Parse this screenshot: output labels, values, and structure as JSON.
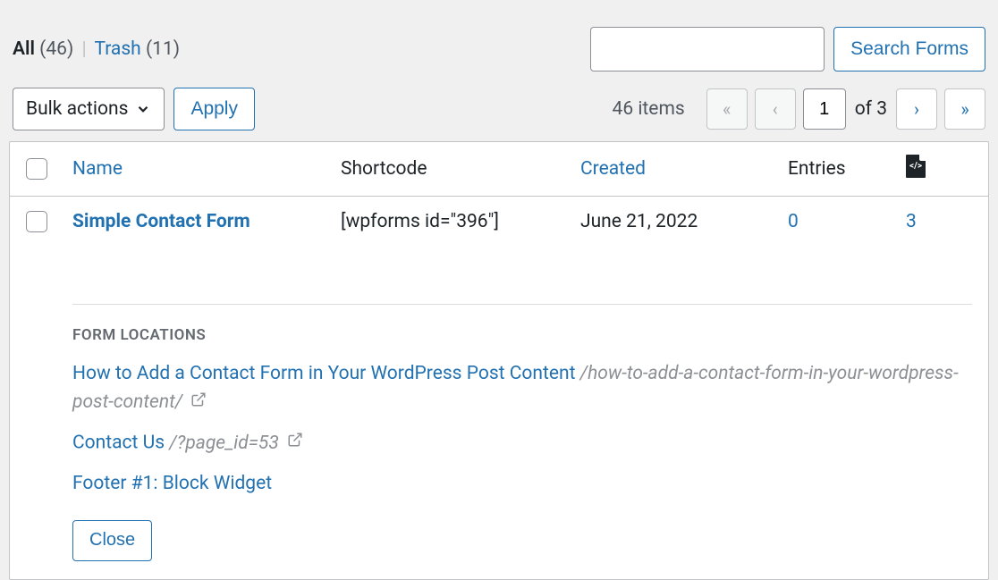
{
  "filters": {
    "all_label": "All",
    "all_count": "(46)",
    "trash_label": "Trash",
    "trash_count": "(11)",
    "separator": "|"
  },
  "search": {
    "button_label": "Search Forms",
    "value": ""
  },
  "bulk": {
    "select_label": "Bulk actions",
    "apply_label": "Apply"
  },
  "pagination": {
    "items_text": "46 items",
    "first_icon": "«",
    "prev_icon": "‹",
    "current_page": "1",
    "of_text": "of 3",
    "next_icon": "›",
    "last_icon": "»"
  },
  "columns": {
    "name": "Name",
    "shortcode": "Shortcode",
    "created": "Created",
    "entries": "Entries"
  },
  "row": {
    "name": "Simple Contact Form",
    "shortcode": "[wpforms id=\"396\"]",
    "created": "June 21, 2022",
    "entries": "0",
    "locations": "3"
  },
  "locations_panel": {
    "title": "FORM LOCATIONS",
    "items": [
      {
        "title": "How to Add a Contact Form in Your WordPress Post Content",
        "slug": "/how-to-add-a-contact-form-in-your-wordpress-post-content/",
        "has_ext": true
      },
      {
        "title": "Contact Us",
        "slug": "/?page_id=53",
        "has_ext": true
      },
      {
        "title": "Footer #1: Block Widget",
        "slug": "",
        "has_ext": false
      }
    ],
    "close_label": "Close"
  }
}
